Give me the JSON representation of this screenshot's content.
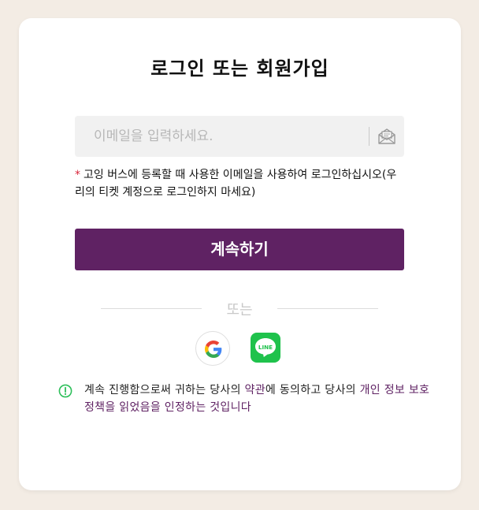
{
  "title": "로그인 또는 회원가입",
  "email": {
    "placeholder": "이메일을 입력하세요.",
    "value": "",
    "icon": "mail-icon"
  },
  "notice": {
    "marker": "*",
    "text": "고잉 버스에 등록할 때 사용한 이메일을 사용하여 로그인하십시오(우리의 티켓 계정으로 로그인하지 마세요)"
  },
  "continue_label": "계속하기",
  "divider_text": "또는",
  "social": {
    "google_icon": "google-icon",
    "line_icon": "line-icon",
    "line_text": "LINE"
  },
  "terms": {
    "icon": "info-icon",
    "prefix": "계속 진행함으로써 귀하는 당사의 ",
    "terms_link": "약관",
    "middle": "에 동의하고 당사의 ",
    "privacy_link": "개인 정보 보호 정책",
    "suffix": "을 읽었음을 인정하는 것입니다"
  },
  "colors": {
    "accent": "#5f2263",
    "background": "#f3ece4",
    "line_green": "#1fc24c",
    "info_green": "#2dbf5a",
    "required": "#d9263b"
  }
}
